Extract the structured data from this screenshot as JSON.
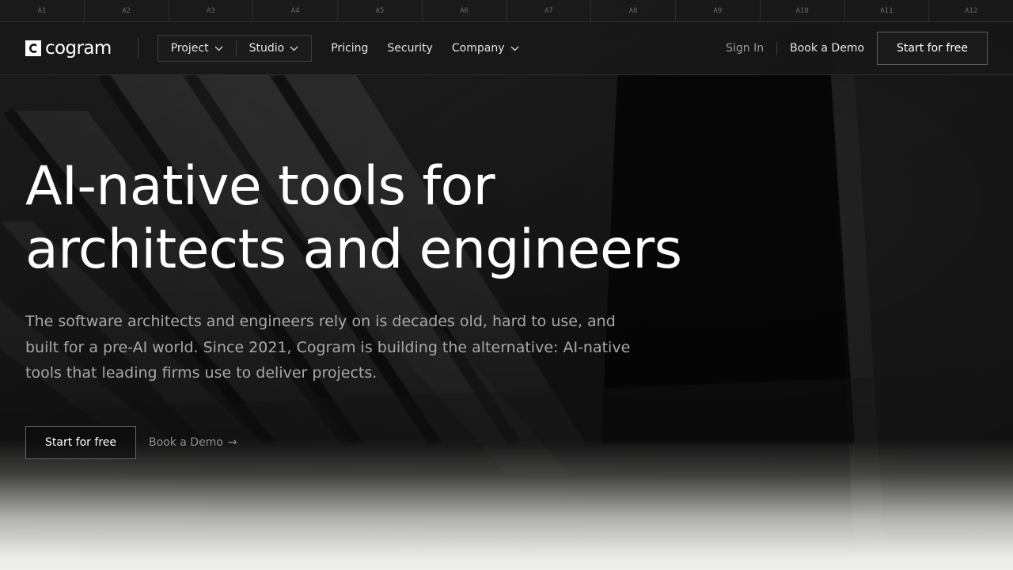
{
  "grid": {
    "columns": [
      "A1",
      "A2",
      "A3",
      "A4",
      "A5",
      "A6",
      "A7",
      "A8",
      "A9",
      "A10",
      "A11",
      "A12"
    ]
  },
  "nav": {
    "logo_text": "cogram",
    "product_menu": [
      {
        "label": "Project",
        "icon": "chevron-down-icon"
      },
      {
        "label": "Studio",
        "icon": "chevron-down-icon"
      }
    ],
    "links": {
      "pricing": "Pricing",
      "security": "Security",
      "company": "Company"
    },
    "sign_in": "Sign In",
    "book_demo": "Book a Demo",
    "cta": "Start for free"
  },
  "hero": {
    "title_line1": "AI-native tools for",
    "title_line2": "architects and engineers",
    "subtitle": "The software architects and engineers rely on is decades old, hard to use, and built for a pre-AI world. Since 2021, Cogram is building the alternative: AI-native tools that leading firms use to deliver projects.",
    "primary_cta": "Start for free",
    "secondary_cta": "Book a Demo",
    "secondary_cta_arrow": "→"
  },
  "colors": {
    "background": "#0d0d0d",
    "text": "#ffffff",
    "muted_text": "#a8a8a8",
    "border": "#5c5c5c",
    "bottom_fade": "#efefeb"
  }
}
